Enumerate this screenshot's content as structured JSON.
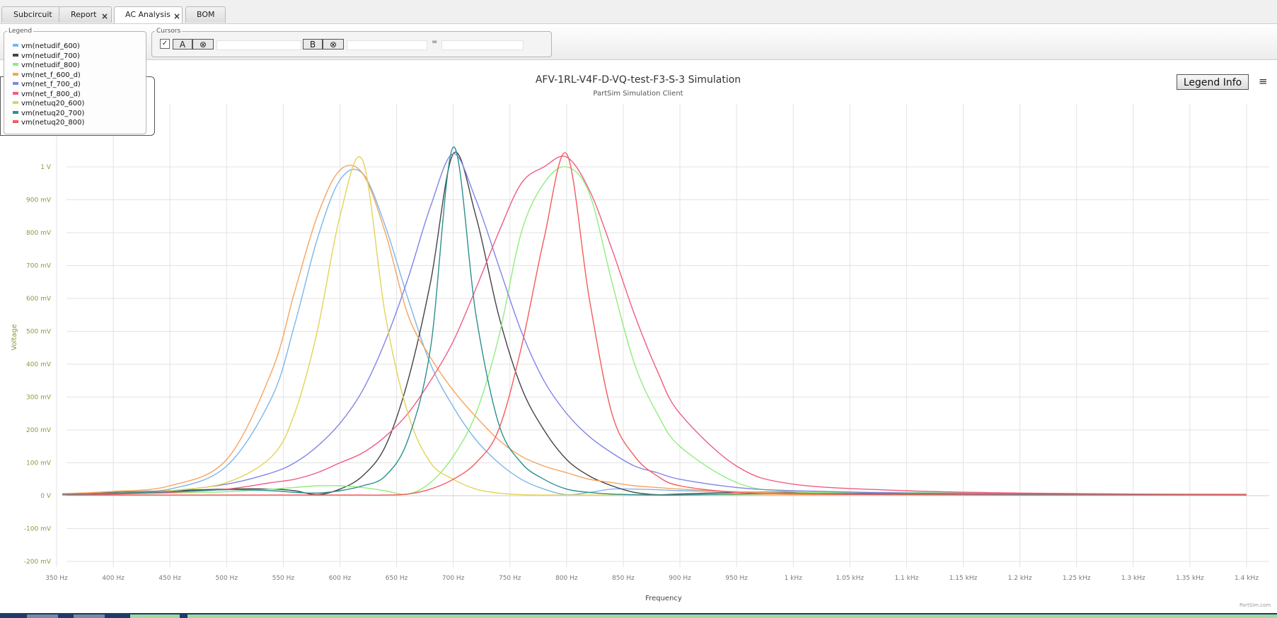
{
  "tabs": [
    {
      "label": "Subcircuit",
      "closable": false,
      "active": false
    },
    {
      "label": "Report",
      "closable": true,
      "active": false
    },
    {
      "label": "AC Analysis",
      "closable": true,
      "active": true
    },
    {
      "label": "BOM",
      "closable": false,
      "active": false
    }
  ],
  "tab_close_glyph": "×",
  "legend_panel": {
    "title": "Legend",
    "items": [
      {
        "label": "vm(netudif_600)",
        "color": "#7cb5ec"
      },
      {
        "label": "vm(netudif_700)",
        "color": "#434348"
      },
      {
        "label": "vm(netudif_800)",
        "color": "#90ed7d"
      },
      {
        "label": "vm(net_f_600_d)",
        "color": "#f7a35c"
      },
      {
        "label": "vm(net_f_700_d)",
        "color": "#8085e9"
      },
      {
        "label": "vm(net_f_800_d)",
        "color": "#f15c80"
      },
      {
        "label": "vm(netuq20_600)",
        "color": "#e4d354"
      },
      {
        "label": "vm(netuq20_700)",
        "color": "#2b908f"
      },
      {
        "label": "vm(netuq20_800)",
        "color": "#f45b5b"
      }
    ]
  },
  "cursors_panel": {
    "title": "Cursors",
    "checkbox_glyph": "✓",
    "cursor_a_label": "A",
    "cursor_b_label": "B",
    "clear_glyph": "⊗",
    "equals": "="
  },
  "legend_info_button": "Legend Info",
  "menu_icon": "hamburger-menu-icon",
  "menu_glyph": "≡",
  "credit": "PartSim.com",
  "chart_data": {
    "type": "line",
    "title": "AFV-1RL-V4F-D-VQ-test-F3-S-3 Simulation",
    "subtitle": "PartSim Simulation Client",
    "xlabel": "Frequency",
    "ylabel": "Voltage",
    "xlim": [
      350,
      1410
    ],
    "ylim": [
      -0.2,
      1.1
    ],
    "grid": true,
    "x_ticks": [
      {
        "v": 350,
        "label": "350 Hz"
      },
      {
        "v": 400,
        "label": "400 Hz"
      },
      {
        "v": 450,
        "label": "450 Hz"
      },
      {
        "v": 500,
        "label": "500 Hz"
      },
      {
        "v": 550,
        "label": "550 Hz"
      },
      {
        "v": 600,
        "label": "600 Hz"
      },
      {
        "v": 650,
        "label": "650 Hz"
      },
      {
        "v": 700,
        "label": "700 Hz"
      },
      {
        "v": 750,
        "label": "750 Hz"
      },
      {
        "v": 800,
        "label": "800 Hz"
      },
      {
        "v": 850,
        "label": "850 Hz"
      },
      {
        "v": 900,
        "label": "900 Hz"
      },
      {
        "v": 950,
        "label": "950 Hz"
      },
      {
        "v": 1000,
        "label": "1 kHz"
      },
      {
        "v": 1050,
        "label": "1.05 kHz"
      },
      {
        "v": 1100,
        "label": "1.1 kHz"
      },
      {
        "v": 1150,
        "label": "1.15 kHz"
      },
      {
        "v": 1200,
        "label": "1.2 kHz"
      },
      {
        "v": 1250,
        "label": "1.25 kHz"
      },
      {
        "v": 1300,
        "label": "1.3 kHz"
      },
      {
        "v": 1350,
        "label": "1.35 kHz"
      },
      {
        "v": 1400,
        "label": "1.4 kHz"
      }
    ],
    "y_ticks": [
      {
        "v": -0.2,
        "label": "-200 mV"
      },
      {
        "v": -0.1,
        "label": "-100 mV"
      },
      {
        "v": 0,
        "label": "0 V"
      },
      {
        "v": 0.1,
        "label": "100 mV"
      },
      {
        "v": 0.2,
        "label": "200 mV"
      },
      {
        "v": 0.3,
        "label": "300 mV"
      },
      {
        "v": 0.4,
        "label": "400 mV"
      },
      {
        "v": 0.5,
        "label": "500 mV"
      },
      {
        "v": 0.6,
        "label": "600 mV"
      },
      {
        "v": 0.7,
        "label": "700 mV"
      },
      {
        "v": 0.8,
        "label": "800 mV"
      },
      {
        "v": 0.9,
        "label": "900 mV"
      },
      {
        "v": 1.0,
        "label": "1 V"
      }
    ],
    "x": [
      355,
      400,
      450,
      500,
      540,
      560,
      580,
      600,
      620,
      640,
      660,
      680,
      700,
      720,
      740,
      760,
      780,
      800,
      820,
      840,
      860,
      880,
      900,
      950,
      1000,
      1100,
      1200,
      1300,
      1400
    ],
    "series": [
      {
        "name": "vm(netudif_600)",
        "color": "#7cb5ec",
        "values": [
          0.005,
          0.01,
          0.02,
          0.09,
          0.3,
          0.52,
          0.78,
          0.96,
          0.98,
          0.82,
          0.6,
          0.4,
          0.27,
          0.17,
          0.1,
          0.05,
          0.02,
          0.003,
          0.01,
          0.02,
          0.02,
          0.018,
          0.015,
          0.012,
          0.01,
          0.007,
          0.005,
          0.004,
          0.003
        ]
      },
      {
        "name": "vm(netudif_700)",
        "color": "#434348",
        "values": [
          0.005,
          0.01,
          0.015,
          0.02,
          0.02,
          0.015,
          0.003,
          0.02,
          0.06,
          0.15,
          0.35,
          0.65,
          1.04,
          0.85,
          0.55,
          0.33,
          0.2,
          0.11,
          0.06,
          0.03,
          0.01,
          0.003,
          0.005,
          0.01,
          0.01,
          0.007,
          0.005,
          0.004,
          0.003
        ]
      },
      {
        "name": "vm(netudif_800)",
        "color": "#90ed7d",
        "values": [
          0.003,
          0.005,
          0.008,
          0.012,
          0.02,
          0.025,
          0.03,
          0.03,
          0.025,
          0.015,
          0.005,
          0.04,
          0.12,
          0.25,
          0.48,
          0.8,
          0.95,
          1.0,
          0.92,
          0.65,
          0.4,
          0.25,
          0.15,
          0.04,
          0.012,
          0.01,
          0.007,
          0.005,
          0.004
        ]
      },
      {
        "name": "vm(net_f_600_d)",
        "color": "#f7a35c",
        "values": [
          0.006,
          0.013,
          0.03,
          0.11,
          0.38,
          0.62,
          0.85,
          0.99,
          0.98,
          0.8,
          0.55,
          0.42,
          0.32,
          0.24,
          0.17,
          0.12,
          0.09,
          0.07,
          0.05,
          0.04,
          0.03,
          0.025,
          0.02,
          0.012,
          0.008,
          0.005,
          0.004,
          0.003,
          0.002
        ]
      },
      {
        "name": "vm(net_f_700_d)",
        "color": "#8085e9",
        "values": [
          0.004,
          0.008,
          0.015,
          0.035,
          0.07,
          0.1,
          0.15,
          0.22,
          0.32,
          0.47,
          0.66,
          0.88,
          1.04,
          0.9,
          0.7,
          0.5,
          0.35,
          0.25,
          0.18,
          0.13,
          0.09,
          0.07,
          0.05,
          0.025,
          0.015,
          0.008,
          0.005,
          0.004,
          0.003
        ]
      },
      {
        "name": "vm(net_f_800_d)",
        "color": "#f15c80",
        "values": [
          0.003,
          0.005,
          0.01,
          0.02,
          0.04,
          0.05,
          0.07,
          0.1,
          0.13,
          0.18,
          0.25,
          0.35,
          0.47,
          0.63,
          0.8,
          0.95,
          1.0,
          1.03,
          0.93,
          0.75,
          0.55,
          0.38,
          0.25,
          0.09,
          0.035,
          0.015,
          0.008,
          0.005,
          0.004
        ]
      },
      {
        "name": "vm(netuq20_600)",
        "color": "#e4d354",
        "values": [
          0.004,
          0.008,
          0.015,
          0.04,
          0.12,
          0.25,
          0.5,
          0.85,
          1.02,
          0.55,
          0.25,
          0.1,
          0.05,
          0.02,
          0.008,
          0.003,
          0.002,
          0.002,
          0.002,
          0.002,
          0.002,
          0.002,
          0.002,
          0.002,
          0.002,
          0.002,
          0.002,
          0.002,
          0.002
        ]
      },
      {
        "name": "vm(netuq20_700)",
        "color": "#2b908f",
        "values": [
          0.004,
          0.007,
          0.012,
          0.018,
          0.015,
          0.01,
          0.008,
          0.015,
          0.03,
          0.06,
          0.17,
          0.45,
          1.06,
          0.55,
          0.22,
          0.1,
          0.05,
          0.02,
          0.01,
          0.005,
          0.003,
          0.002,
          0.002,
          0.005,
          0.006,
          0.005,
          0.004,
          0.003,
          0.002
        ]
      },
      {
        "name": "vm(netuq20_800)",
        "color": "#f45b5b",
        "values": [
          0.002,
          0.002,
          0.002,
          0.002,
          0.002,
          0.002,
          0.002,
          0.002,
          0.002,
          0.002,
          0.005,
          0.02,
          0.05,
          0.1,
          0.2,
          0.45,
          0.78,
          1.04,
          0.6,
          0.25,
          0.12,
          0.06,
          0.03,
          0.01,
          0.005,
          0.003,
          0.002,
          0.002,
          0.002
        ]
      }
    ]
  }
}
